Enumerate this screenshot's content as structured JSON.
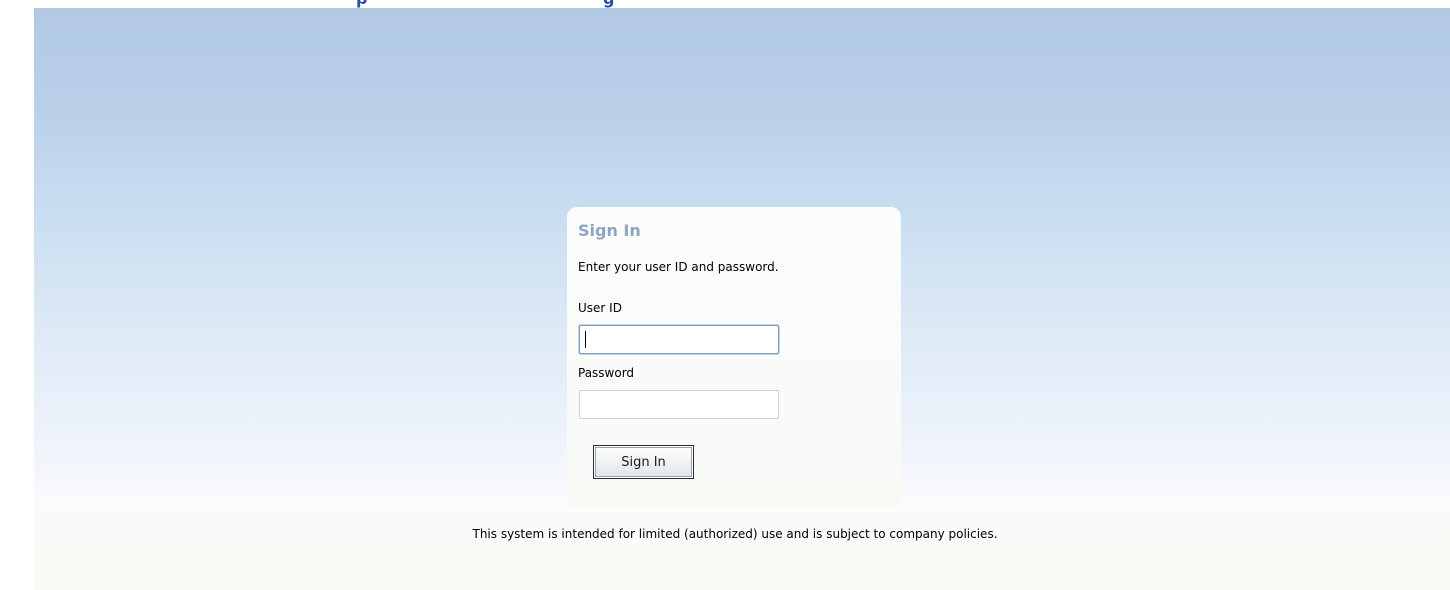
{
  "header": {
    "title_fragment_left": "p",
    "title_fragment_right": "g"
  },
  "signin": {
    "title": "Sign In",
    "instructions": "Enter your user ID and password.",
    "user_id_label": "User ID",
    "user_id_value": "",
    "password_label": "Password",
    "password_value": "",
    "button_label": "Sign In"
  },
  "footer": {
    "notice": "This system is intended for limited (authorized) use and is subject to company policies."
  },
  "colors": {
    "background_top": "#b2c9e4",
    "background_bottom": "#f8fbf6",
    "title_color": "#8ea5c2",
    "header_text": "#2a4f9a",
    "focused_input_border": "#7f9db9"
  }
}
